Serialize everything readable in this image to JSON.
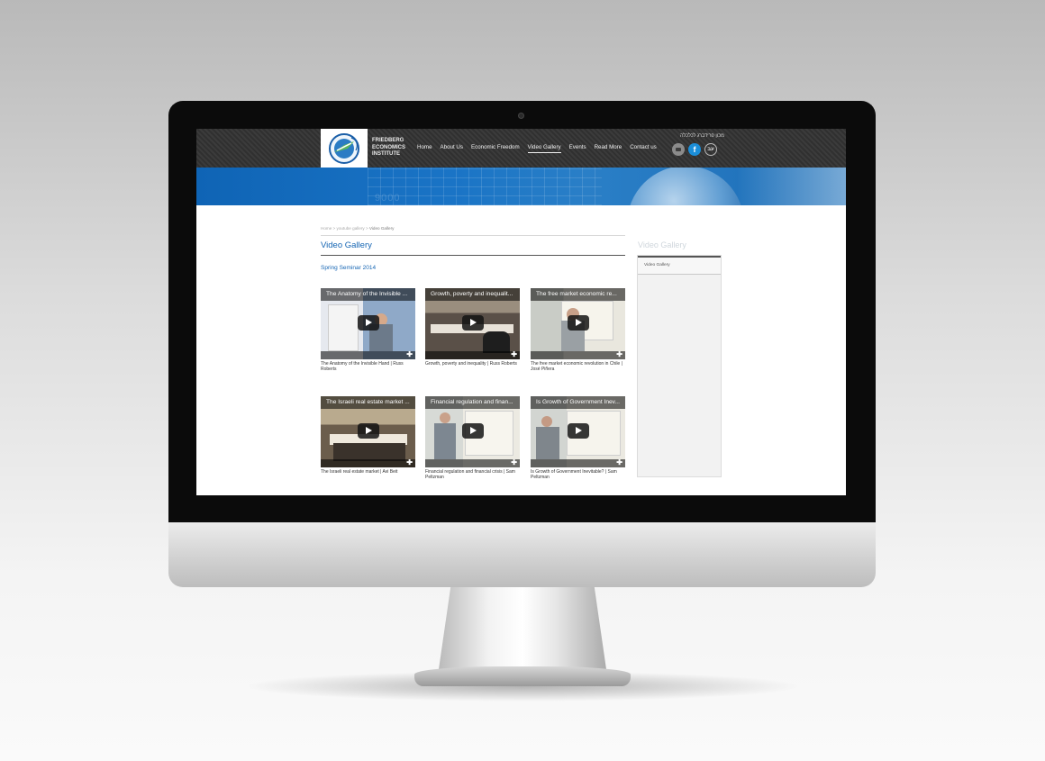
{
  "site": {
    "brand_lines": [
      "FRIEDBERG",
      "ECONOMICS",
      "INSTITUTE"
    ],
    "hebrew_name": "מכון פרידברג לכלכלה",
    "hebrew_lang_label": "עב"
  },
  "nav": {
    "items": [
      {
        "label": "Home",
        "active": false
      },
      {
        "label": "About Us",
        "active": false
      },
      {
        "label": "Economic Freedom",
        "active": false
      },
      {
        "label": "Video Gallery",
        "active": true
      },
      {
        "label": "Events",
        "active": false
      },
      {
        "label": "Read More",
        "active": false
      },
      {
        "label": "Contact us",
        "active": false
      }
    ]
  },
  "banner": {
    "numbers_text": "9000"
  },
  "breadcrumb": {
    "parts": [
      "Home",
      "youtube gallery",
      "Video Gallery"
    ],
    "separator": ">"
  },
  "page": {
    "title": "Video Gallery",
    "section_title": "Spring Seminar 2014"
  },
  "videos": [
    {
      "overlay_title": "The Anatomy of the Invisible ...",
      "caption": "The Anatomy of the Invisible Hand | Russ Roberts"
    },
    {
      "overlay_title": "Growth, poverty and inequalit...",
      "caption": "Growth, poverty and inequality | Russ Roberts"
    },
    {
      "overlay_title": "The free market economic re...",
      "caption": "The free market economic revolution in Chile | José Piñera"
    },
    {
      "overlay_title": "The Israeli real estate market ...",
      "caption": "The Israeli real estate market | Avi Beit"
    },
    {
      "overlay_title": "Financial regulation and finan...",
      "caption": "Financial regulation and financial crisis | Sam Peltzman"
    },
    {
      "overlay_title": "Is Growth of Government Inev...",
      "caption": "Is Growth of Government Inevitable? | Sam Peltzman"
    }
  ],
  "sidebar": {
    "title": "Video Gallery",
    "items": [
      "Video Gallery"
    ]
  },
  "colors": {
    "accent": "#1565b3",
    "header_bg": "#333333",
    "banner": "#1a74c6"
  },
  "icons": [
    "youtube-icon",
    "facebook-icon",
    "play-icon",
    "expand-icon"
  ]
}
